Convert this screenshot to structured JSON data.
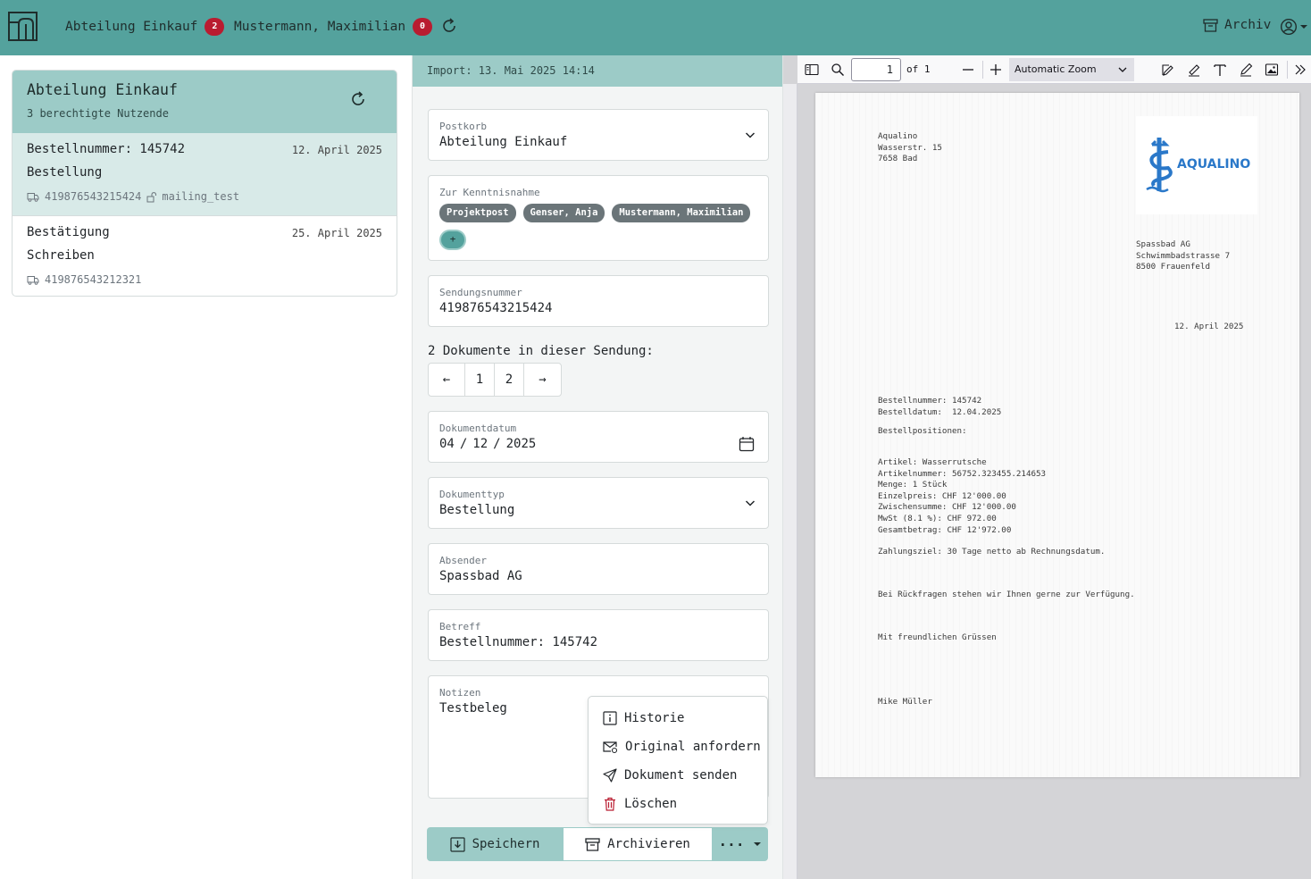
{
  "topbar": {
    "nav": [
      {
        "label": "Abteilung Einkauf",
        "count": "2"
      },
      {
        "label": "Mustermann, Maximilian",
        "count": "0"
      }
    ],
    "archiv_label": "Archiv"
  },
  "mailbox": {
    "title": "Abteilung Einkauf",
    "subtitle": "3 berechtigte Nutzende",
    "items": [
      {
        "title": "Bestellnummer: 145742",
        "date": "12. April 2025",
        "type": "Bestellung",
        "tracking": "419876543215424",
        "user": "mailing_test"
      },
      {
        "title": "Bestätigung",
        "date": "25. April 2025",
        "type": "Schreiben",
        "tracking": "419876543212321"
      }
    ]
  },
  "detail": {
    "import": "Import: 13. Mai 2025 14:14",
    "postkorb": {
      "label": "Postkorb",
      "value": "Abteilung Einkauf"
    },
    "kenntnis": {
      "label": "Zur Kenntnisnahme",
      "chips": [
        "Projektpost",
        "Genser, Anja",
        "Mustermann, Maximilian"
      ],
      "add": "+"
    },
    "sendung": {
      "label": "Sendungsnummer",
      "value": "419876543215424"
    },
    "docs_label": "2 Dokumente in dieser Sendung:",
    "pager": {
      "prev": "←",
      "p1": "1",
      "p2": "2",
      "next": "→"
    },
    "datum": {
      "label": "Dokumentdatum",
      "mm": "04",
      "dd": "12",
      "yyyy": "2025",
      "sep": "/"
    },
    "typ": {
      "label": "Dokumenttyp",
      "value": "Bestellung"
    },
    "absender": {
      "label": "Absender",
      "value": "Spassbad AG"
    },
    "betreff": {
      "label": "Betreff",
      "value": "Bestellnummer: 145742"
    },
    "notizen": {
      "label": "Notizen",
      "value": "Testbeleg"
    }
  },
  "menu": {
    "items": [
      {
        "label": "Historie",
        "icon": "info-icon"
      },
      {
        "label": "Original anfordern",
        "icon": "envelope-at-icon"
      },
      {
        "label": "Dokument senden",
        "icon": "send-icon"
      },
      {
        "label": "Löschen",
        "icon": "trash-icon"
      }
    ]
  },
  "buttons": {
    "save": "Speichern",
    "archive": "Archivieren",
    "more": "···"
  },
  "pdf": {
    "page_number": "1",
    "of_label": "of 1",
    "zoom": "Automatic Zoom",
    "sender_address": "Aqualino\nWasserstr. 15\n7658 Bad",
    "logo_text": "AQUALINO",
    "recipient_address": "Spassbad AG\nSchwimmbadstrasse 7\n8500 Frauenfeld",
    "date": "12. April 2025",
    "order": "Bestellnummer: 145742\nBestelldatum:  12.04.2025",
    "positions_heading": "Bestellpositionen:",
    "positions": "Artikel: Wasserrutsche\nArtikelnummer: 56752.323455.214653\nMenge: 1 Stück\nEinzelpreis: CHF 12'000.00\nZwischensumme: CHF 12'000.00\nMwSt (8.1 %): CHF 972.00\nGesamtbetrag: CHF 12'972.00",
    "payment": "Zahlungsziel: 30 Tage netto ab Rechnungsdatum.",
    "questions": "Bei Rückfragen stehen wir Ihnen gerne zur Verfügung.",
    "greeting": "Mit freundlichen Grüssen",
    "signature": "Mike Müller"
  },
  "colors": {
    "brand": "#54a29d",
    "brand_light": "#9ccbc7",
    "badge": "#b91c30"
  }
}
